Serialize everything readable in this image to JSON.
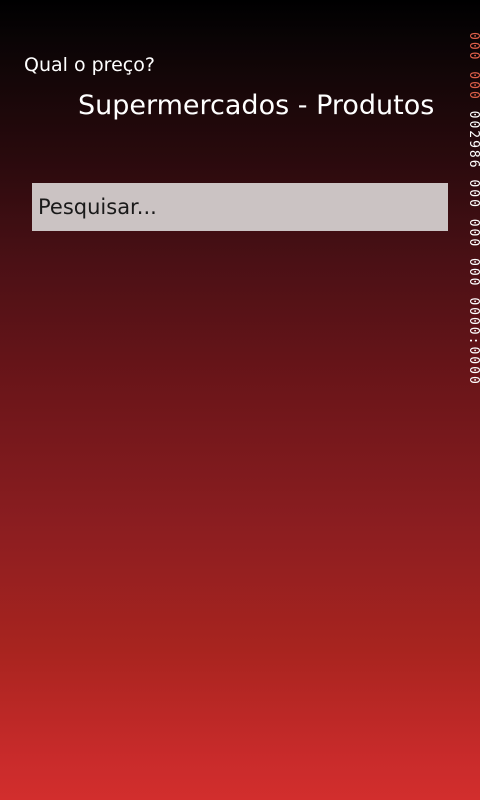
{
  "app": {
    "title": "Qual o preço?",
    "page_title": "Supermercados - Produtos"
  },
  "search": {
    "placeholder": "Pesquisar...",
    "value": ""
  },
  "debug_counter": {
    "highlight_text": "000 000",
    "text": " 002986 000 000 000 0000:0000"
  },
  "colors": {
    "background_top": "#000000",
    "background_bottom": "#d22e2d",
    "search_box": "#cbc3c3",
    "counter_highlight": "#e0604a"
  }
}
